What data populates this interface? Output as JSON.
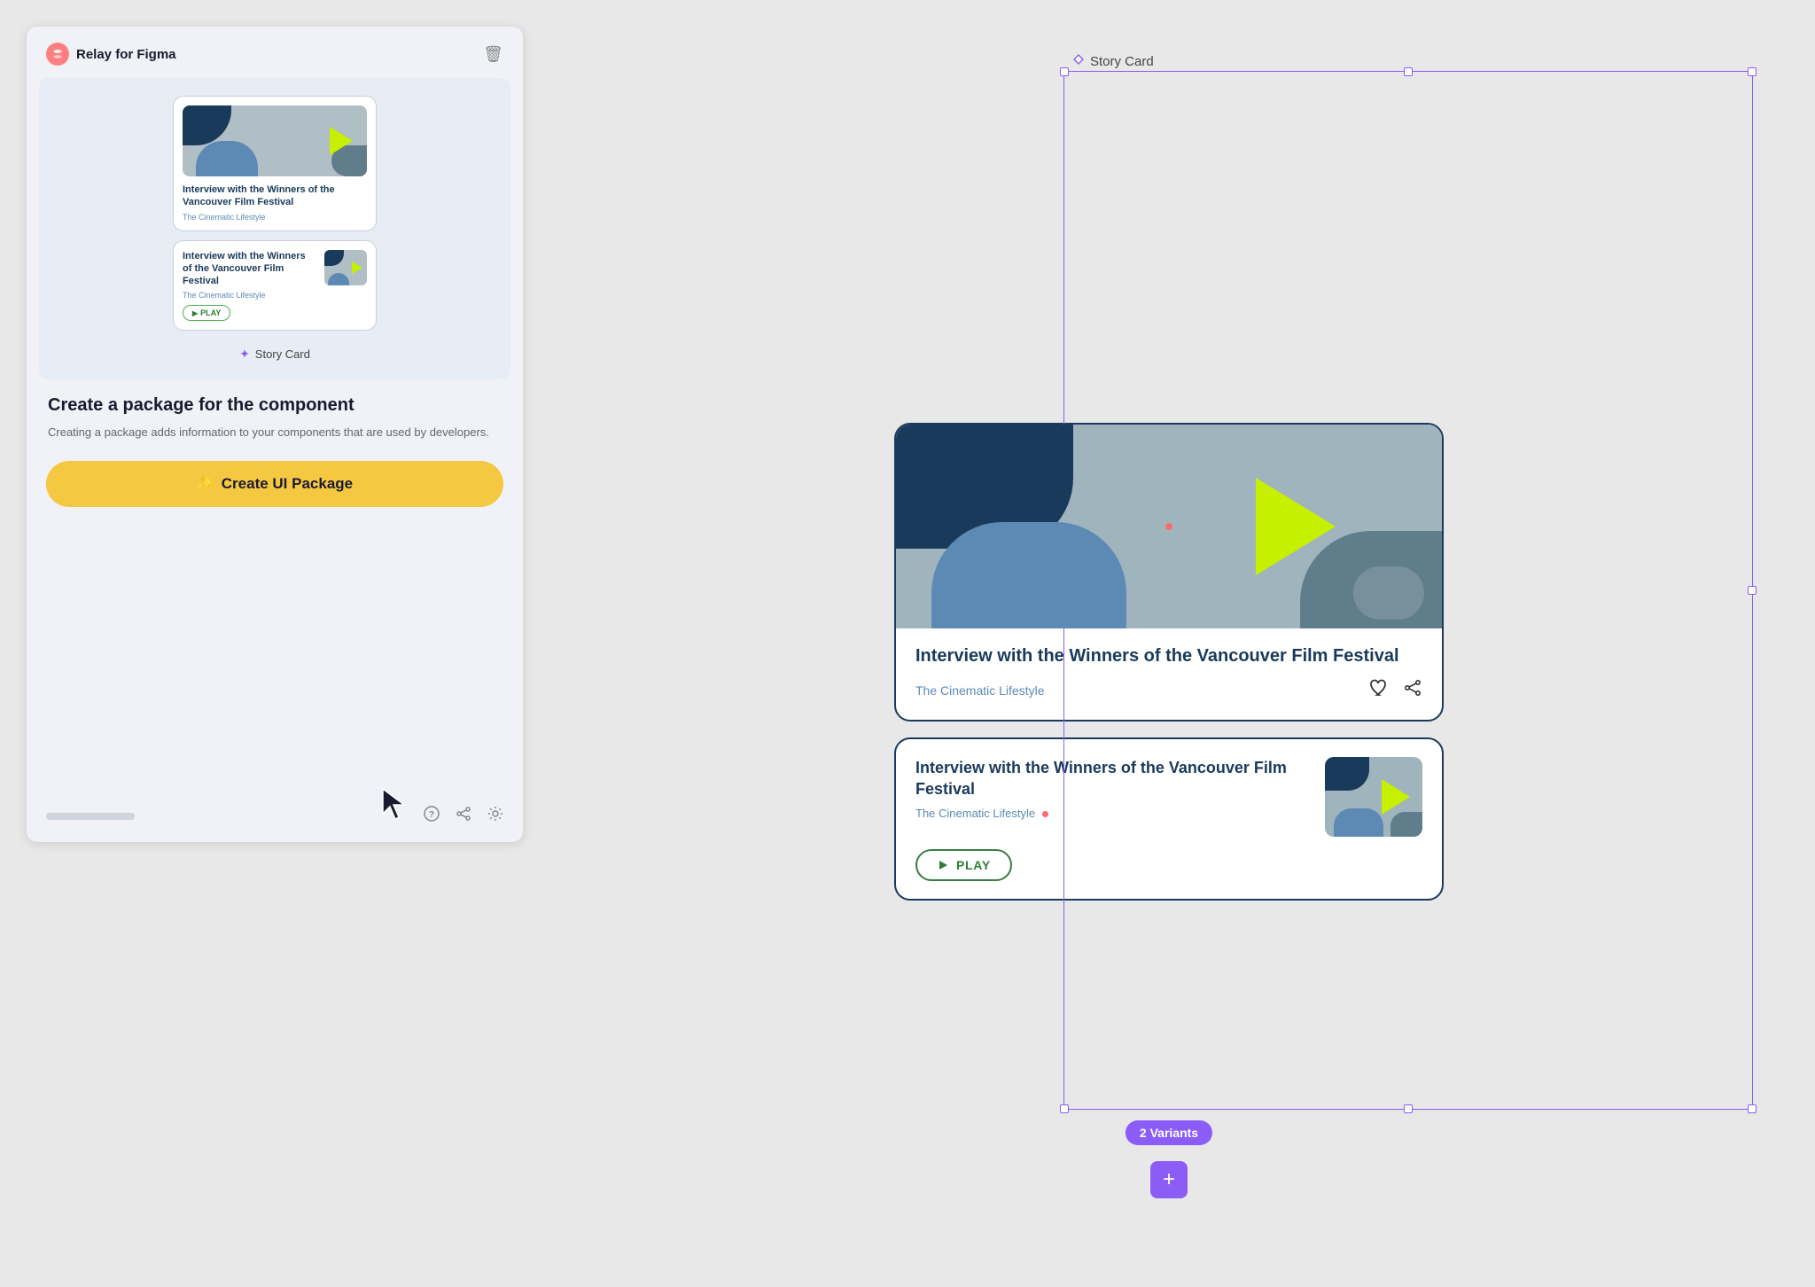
{
  "app": {
    "title": "Relay for Figma"
  },
  "left_panel": {
    "component_label": "Story Card",
    "create_heading": "Create a package for the component",
    "create_desc": "Creating a package adds information to your components that are used by developers.",
    "create_btn_label": "Create UI Package",
    "create_btn_icon": "✨"
  },
  "cards": {
    "v1": {
      "title": "Interview with the Winners of the Vancouver Film Festival",
      "source": "The Cinematic Lifestyle"
    },
    "v2": {
      "title": "Interview with the Winners of the Vancouver Film Festival",
      "source": "The Cinematic Lifestyle",
      "play_label": "PLAY"
    }
  },
  "right_panel": {
    "story_card_label": "Story Card",
    "variants_badge": "2 Variants",
    "add_btn": "+"
  },
  "icons": {
    "diamond": "✦",
    "heart": "♡",
    "share": "⎇",
    "help": "?",
    "settings": "⚙",
    "trash": "🗑"
  }
}
